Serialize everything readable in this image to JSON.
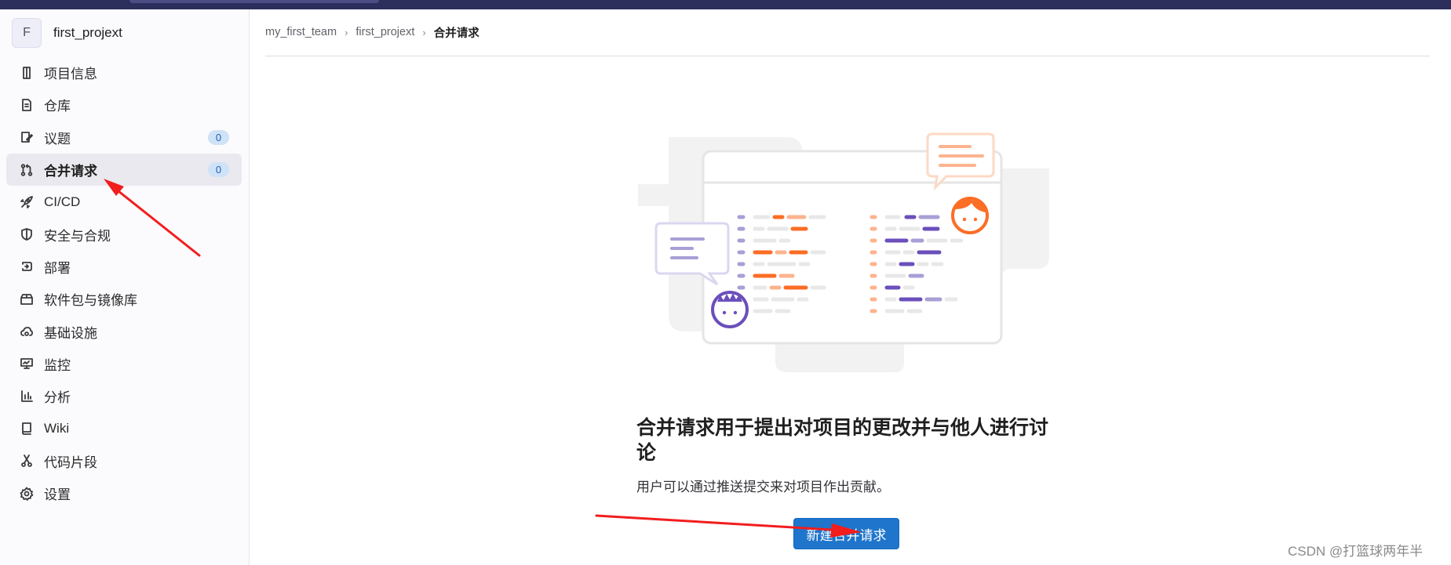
{
  "project": {
    "avatar_letter": "F",
    "name": "first_projext"
  },
  "sidebar": {
    "items": [
      {
        "label": "项目信息",
        "icon": "project-info-icon"
      },
      {
        "label": "仓库",
        "icon": "file-icon"
      },
      {
        "label": "议题",
        "icon": "issues-icon",
        "count": "0"
      },
      {
        "label": "合并请求",
        "icon": "merge-request-icon",
        "count": "0",
        "active": true
      },
      {
        "label": "CI/CD",
        "icon": "rocket-icon"
      },
      {
        "label": "安全与合规",
        "icon": "shield-icon"
      },
      {
        "label": "部署",
        "icon": "deployments-icon"
      },
      {
        "label": "软件包与镜像库",
        "icon": "package-icon"
      },
      {
        "label": "基础设施",
        "icon": "cloud-gear-icon"
      },
      {
        "label": "监控",
        "icon": "monitor-icon"
      },
      {
        "label": "分析",
        "icon": "chart-icon"
      },
      {
        "label": "Wiki",
        "icon": "book-icon"
      },
      {
        "label": "代码片段",
        "icon": "snippet-scissors-icon"
      },
      {
        "label": "设置",
        "icon": "settings-gear-icon"
      }
    ]
  },
  "breadcrumb": {
    "team": "my_first_team",
    "project": "first_projext",
    "current": "合并请求"
  },
  "empty_state": {
    "title": "合并请求用于提出对项目的更改并与他人进行讨论",
    "description": "用户可以通过推送提交来对项目作出贡献。",
    "button": "新建合并请求"
  },
  "watermark": "CSDN @打篮球两年半",
  "colors": {
    "accent_blue": "#1f75cb",
    "annotation_red": "#f21d1d",
    "illustration_orange": "#fc6d26",
    "illustration_purple": "#6b4fbb",
    "topbar": "#2c2e5c"
  }
}
